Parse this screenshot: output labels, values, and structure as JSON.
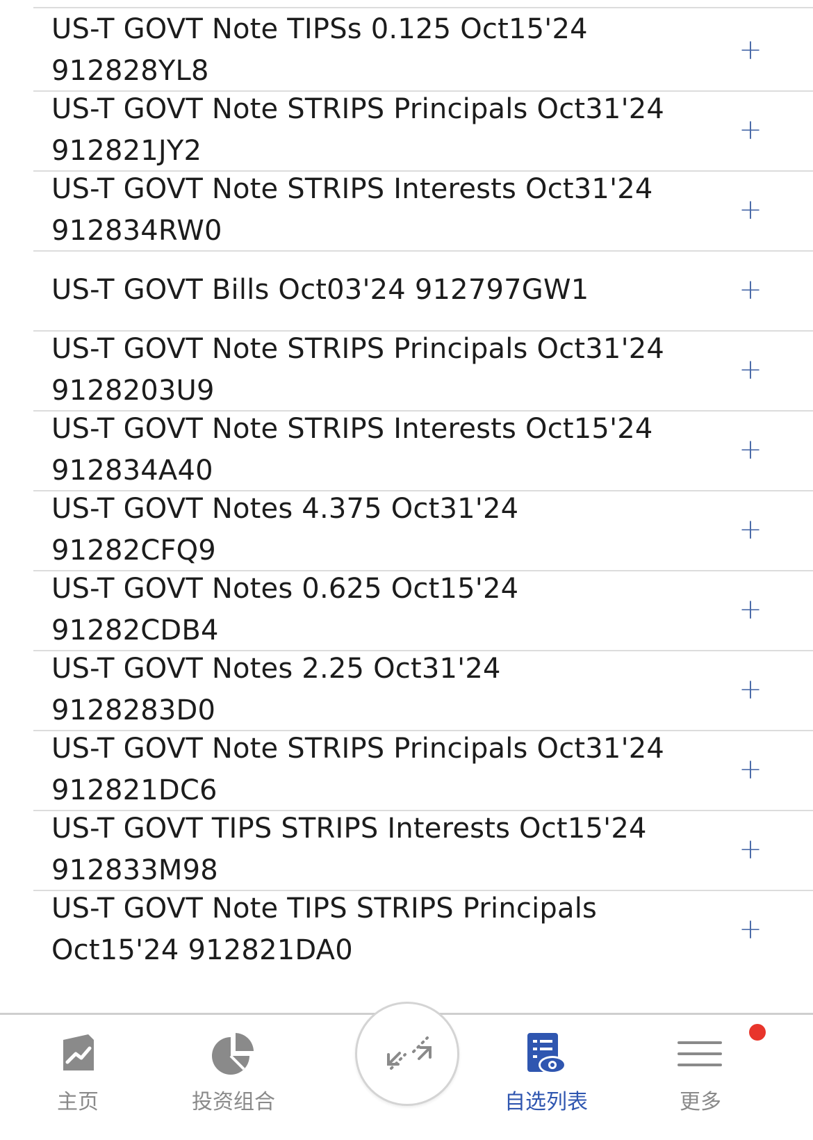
{
  "securities": [
    {
      "line1": "US-T GOVT Note TIPSs 0.125 Oct15'24",
      "line2": "912828YL8"
    },
    {
      "line1": "US-T GOVT Note STRIPS Principals Oct31'24",
      "line2": "912821JY2"
    },
    {
      "line1": "US-T GOVT Note STRIPS Interests Oct31'24",
      "line2": "912834RW0"
    },
    {
      "line1": "US-T GOVT Bills Oct03'24 912797GW1",
      "line2": ""
    },
    {
      "line1": "US-T GOVT Note STRIPS Principals Oct31'24",
      "line2": "9128203U9"
    },
    {
      "line1": "US-T GOVT Note STRIPS Interests Oct15'24",
      "line2": "912834A40"
    },
    {
      "line1": "US-T GOVT Notes 4.375 Oct31'24",
      "line2": "91282CFQ9"
    },
    {
      "line1": "US-T GOVT Notes 0.625 Oct15'24",
      "line2": "91282CDB4"
    },
    {
      "line1": "US-T GOVT Notes 2.25 Oct31'24",
      "line2": "9128283D0"
    },
    {
      "line1": "US-T GOVT Note STRIPS Principals Oct31'24",
      "line2": "912821DC6"
    },
    {
      "line1": "US-T GOVT TIPS STRIPS Interests Oct15'24",
      "line2": "912833M98"
    },
    {
      "line1": "US-T GOVT Note TIPS STRIPS Principals",
      "line2": "Oct15'24 912821DA0"
    }
  ],
  "add_symbol": "+",
  "tabbar": {
    "home": {
      "label": "主页",
      "icon": "chart-trend-icon"
    },
    "portfolio": {
      "label": "投资组合",
      "icon": "pie-chart-icon"
    },
    "center": {
      "icon": "expand-arrows-icon"
    },
    "watchlist": {
      "label": "自选列表",
      "icon": "watchlist-eye-icon"
    },
    "more": {
      "label": "更多",
      "icon": "hamburger-menu-icon"
    }
  },
  "colors": {
    "accent": "#2f56b0",
    "add_icon": "#4a6aa8",
    "inactive": "#8a8a8a",
    "badge": "#e8352b"
  }
}
